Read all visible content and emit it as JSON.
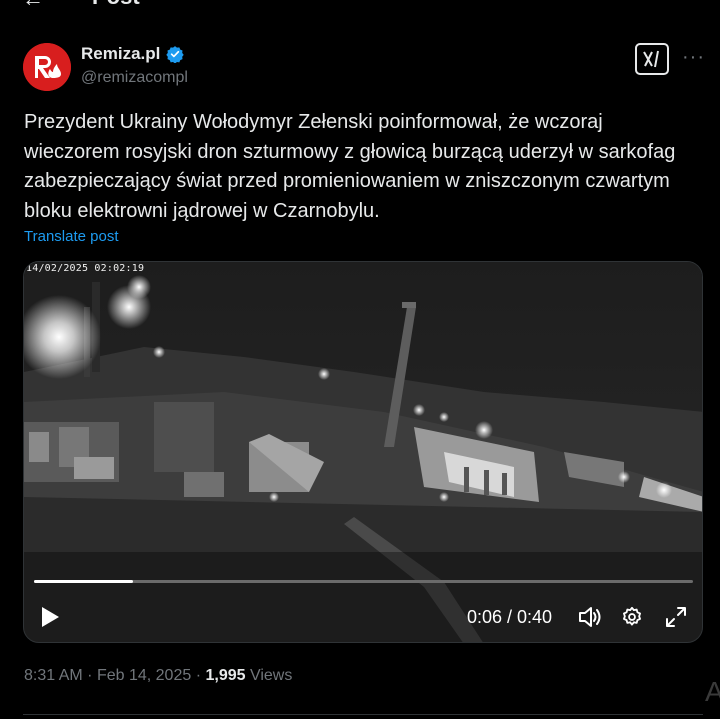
{
  "header": {
    "back_icon": "arrow-left-icon",
    "title": "Post"
  },
  "author": {
    "display_name": "Remiza.pl",
    "handle": "@remizacompl",
    "verified": true,
    "avatar_color": "#d81e1e"
  },
  "actions": {
    "grok_icon": "grok-icon",
    "more_icon": "more-icon",
    "more_label": "···"
  },
  "post": {
    "text": "Prezydent Ukrainy Wołodymyr Zełenski poinformował, że wczoraj wieczorem rosyjski dron szturmowy z głowicą burzącą uderzył w sarkofag zabezpieczający świat przed promieniowaniem w zniszczonym czwartym bloku elektrowni jądrowej w Czarnobylu.",
    "translate_label": "Translate post"
  },
  "video": {
    "overlay_timestamp": "14/02/2025 02:02:19",
    "current_time": "0:06",
    "duration": "0:40",
    "time_display": "0:06 / 0:40",
    "progress_fraction": 0.15
  },
  "meta": {
    "time": "8:31 AM",
    "date": "Feb 14, 2025",
    "views_count": "1,995",
    "views_label": "Views"
  },
  "colors": {
    "accent": "#1d9bf0",
    "muted": "#71767b",
    "text": "#e7e9ea"
  },
  "side_glyph": "A"
}
